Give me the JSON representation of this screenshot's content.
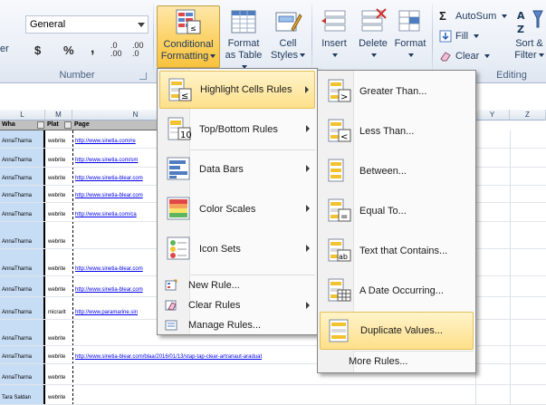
{
  "ribbon": {
    "number_format": "General",
    "number_group_label": "Number",
    "editing_group_label": "Editing",
    "currency_symbol": "$",
    "percent_symbol": "%",
    "comma_symbol": ",",
    "increase_decimal": ".0\n.00",
    "decrease_decimal": ".00\n.0",
    "partial_left_label": "er",
    "conditional_formatting": {
      "line1": "Conditional",
      "line2": "Formatting"
    },
    "format_as_table": {
      "line1": "Format",
      "line2": "as Table"
    },
    "cell_styles": {
      "line1": "Cell",
      "line2": "Styles"
    },
    "insert_label": "Insert",
    "delete_label": "Delete",
    "format_label": "Format",
    "autosum_label": "AutoSum",
    "fill_label": "Fill",
    "clear_label": "Clear",
    "sort_filter": {
      "line1": "Sort &",
      "line2": "Filter"
    }
  },
  "sheet": {
    "column_headers": [
      "L",
      "M",
      "N",
      "Y",
      "Z"
    ],
    "header_row": [
      "Wha",
      "Plat",
      "Page"
    ],
    "rows": [
      {
        "who": "AnnaTharna",
        "plat": "webrite",
        "page": "http://www.sinetia.com/re"
      },
      {
        "who": "AnnaTharna",
        "plat": "webrite",
        "page": "http://www.sinetia.com/sm"
      },
      {
        "who": "AnnaTharna",
        "plat": "webrite",
        "page": "http://www.sinetia-blear.com"
      },
      {
        "who": "AnnaTharna",
        "plat": "webrite",
        "page": "http://www.sinetia-blear.com"
      },
      {
        "who": "AnnaTharna",
        "plat": "webrite",
        "page": "http://www.sinetia.com/ca"
      },
      {
        "who": "AnnaTharna",
        "plat": "webrite",
        "page": ""
      },
      {
        "who": "AnnaTharna",
        "plat": "webrite",
        "page": "http://www.sinetia-blear.com"
      },
      {
        "who": "AnnaTharna",
        "plat": "webrite",
        "page": "http://www.sinetia-blear.com"
      },
      {
        "who": "AnnaTharna",
        "plat": "micrarit",
        "page": "http://www.paramarine.sin"
      },
      {
        "who": "AnnaTharna",
        "plat": "webrite",
        "page": ""
      },
      {
        "who": "AnnaTharna",
        "plat": "webrite",
        "page": "http://www.sinetia-blear.com/blaa/2016/01/13/stap-tap-clear-artranaut-araduat"
      },
      {
        "who": "AnnaTharna",
        "plat": "webrite",
        "page": ""
      },
      {
        "who": "Tara Saldan",
        "plat": "webrite",
        "page": ""
      }
    ]
  },
  "cf_menu": {
    "items": [
      {
        "label": "Highlight Cells Rules",
        "icon": "highlight-cells-icon",
        "highlighted": true
      },
      {
        "label": "Top/Bottom Rules",
        "icon": "top-bottom-icon",
        "highlighted": false
      },
      {
        "label": "Data Bars",
        "icon": "data-bars-icon",
        "highlighted": false
      },
      {
        "label": "Color Scales",
        "icon": "color-scales-icon",
        "highlighted": false
      },
      {
        "label": "Icon Sets",
        "icon": "icon-sets-icon",
        "highlighted": false
      }
    ],
    "new_rule": "New Rule...",
    "clear_rules": "Clear Rules",
    "manage_rules": "Manage Rules..."
  },
  "hc_menu": {
    "items": [
      {
        "label": "Greater Than...",
        "icon": "greater-than-icon",
        "highlighted": false
      },
      {
        "label": "Less Than...",
        "icon": "less-than-icon",
        "highlighted": false
      },
      {
        "label": "Between...",
        "icon": "between-icon",
        "highlighted": false
      },
      {
        "label": "Equal To...",
        "icon": "equal-to-icon",
        "highlighted": false
      },
      {
        "label": "Text that Contains...",
        "icon": "text-contains-icon",
        "highlighted": false
      },
      {
        "label": "A Date Occurring...",
        "icon": "date-occurring-icon",
        "highlighted": false
      },
      {
        "label": "Duplicate Values...",
        "icon": "duplicate-values-icon",
        "highlighted": true
      }
    ],
    "more_rules": "More Rules..."
  },
  "colors": {
    "highlight": "#fde08a",
    "selected_column": "#c7ddf5",
    "ribbon_bg": "#e9eef6"
  }
}
